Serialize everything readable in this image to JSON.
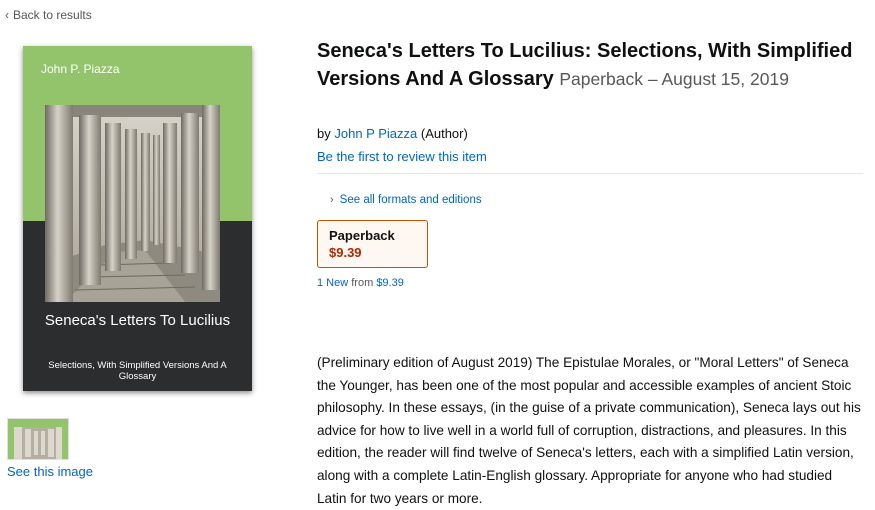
{
  "nav": {
    "back_label": "Back to results"
  },
  "cover": {
    "author": "John P. Piazza",
    "title": "Seneca's Letters To Lucilius",
    "subtitle": "Selections, With Simplified Versions And A Glossary"
  },
  "gallery": {
    "see_image_label": "See this image"
  },
  "product": {
    "title": "Seneca's Letters To Lucilius: Selections, With Simplified Versions And A Glossary",
    "format_date": "Paperback – August 15, 2019",
    "by_label": "by",
    "author_name": "John P Piazza",
    "author_role": "(Author)",
    "review_link": "Be the first to review this item",
    "formats_link": "See all formats and editions",
    "swatch": {
      "format": "Paperback",
      "price": "$9.39"
    },
    "offers": {
      "new_link": "1 New",
      "from_label": "from",
      "from_price": "$9.39"
    },
    "description": "(Preliminary edition of August 2019) The Epistulae Morales, or \"Moral Letters\" of Seneca the Younger, has been one of the most popular and accessible examples of ancient Stoic philosophy. In these essays, (in the guise of a private communication), Seneca lays out his advice for how to live well in a world full of corruption, distractions, and pleasures. In this edition, the reader will find twelve of Seneca's letters, each with a simplified Latin version, along with a complete Latin-English glossary. Appropriate for anyone who had studied Latin for two years or more."
  },
  "colors": {
    "link": "#0066c0",
    "price": "#b12704",
    "swatch_border": "#c45500",
    "cover_green": "#93c46b",
    "cover_dark": "#2b2d2e"
  }
}
